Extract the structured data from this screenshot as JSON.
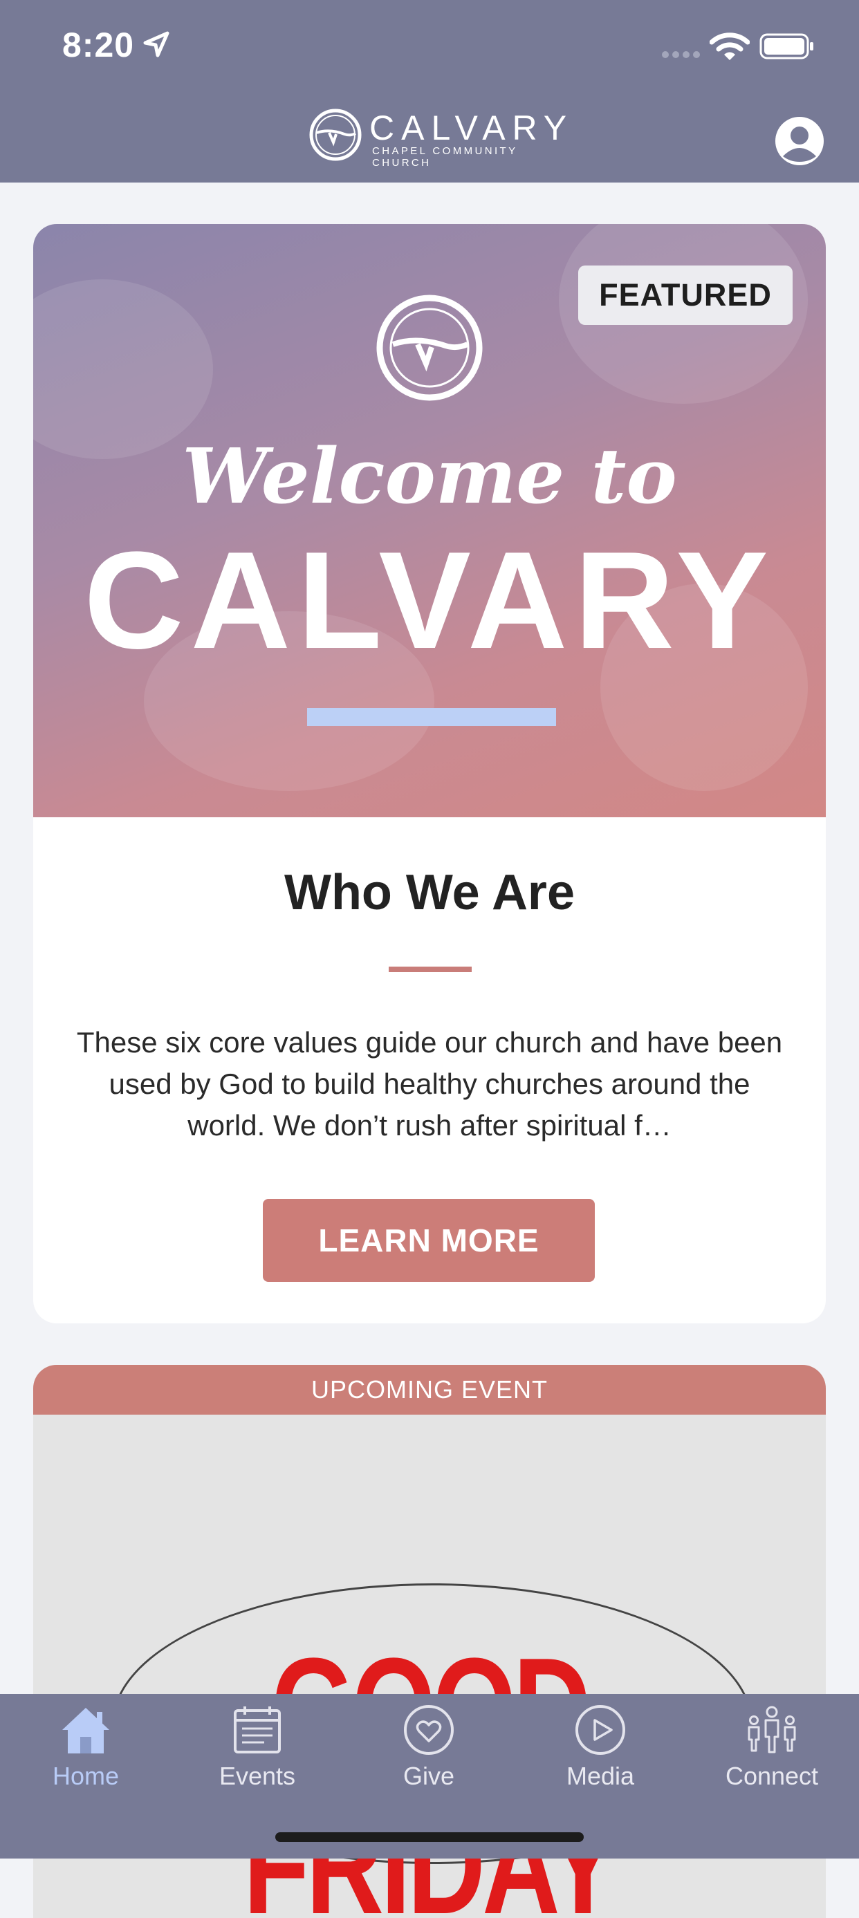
{
  "status_bar": {
    "time": "8:20"
  },
  "header": {
    "logo_title": "CALVARY",
    "logo_subtitle": "CHAPEL COMMUNITY CHURCH",
    "profile_icon": "user-circle-icon"
  },
  "featured_card": {
    "badge": "FEATURED",
    "hero_welcome": "Welcome to",
    "hero_brand": "CALVARY",
    "title": "Who We Are",
    "body": "These six core values guide our church and have been used by God to build healthy churches around the world. We don’t rush after spiritual f…",
    "button_label": "LEARN MORE"
  },
  "event_card": {
    "banner": "UPCOMING EVENT",
    "title": "GOOD FRIDAY"
  },
  "tabbar": {
    "tabs": [
      {
        "label": "Home",
        "icon": "home-icon",
        "active": true
      },
      {
        "label": "Events",
        "icon": "calendar-icon",
        "active": false
      },
      {
        "label": "Give",
        "icon": "heart-icon",
        "active": false
      },
      {
        "label": "Media",
        "icon": "play-icon",
        "active": false
      },
      {
        "label": "Connect",
        "icon": "people-icon",
        "active": false
      }
    ]
  },
  "colors": {
    "header_bg": "#777a96",
    "accent": "#cc7d78",
    "active_tab": "#b9ccf7",
    "hero_bar": "#bcd0f6"
  }
}
